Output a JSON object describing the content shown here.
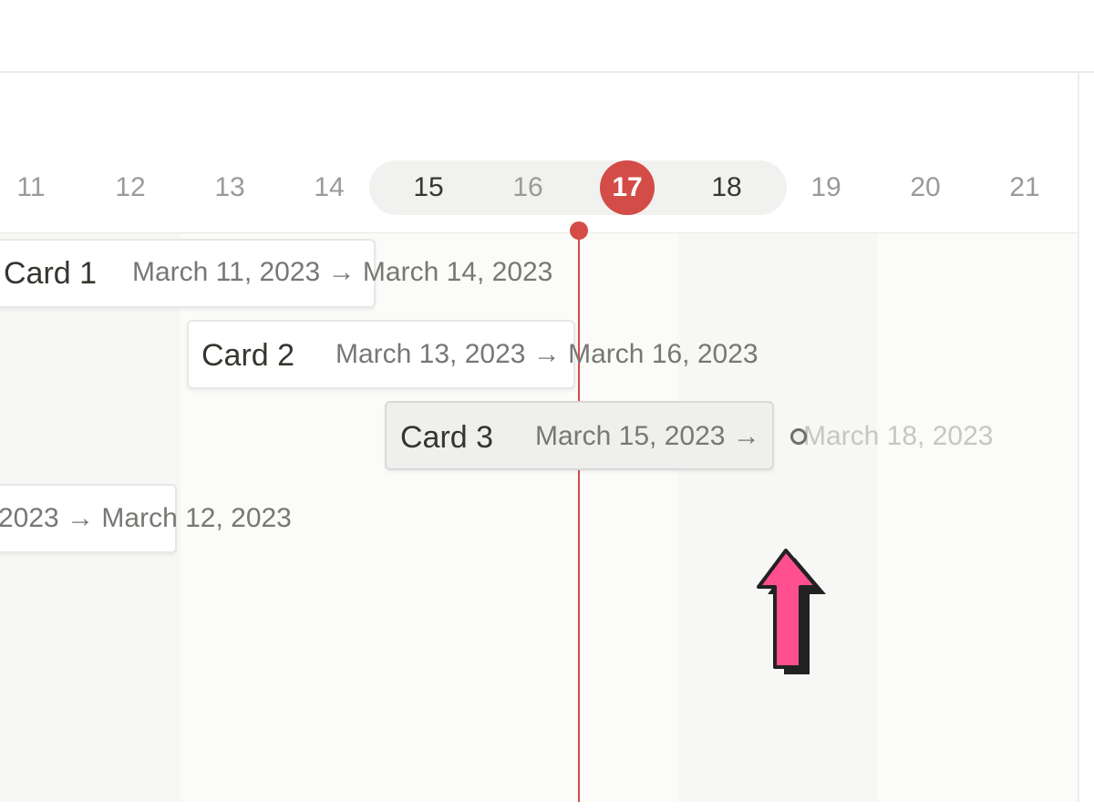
{
  "timeline": {
    "days": [
      {
        "label": "11",
        "state": "outside"
      },
      {
        "label": "12",
        "state": "outside"
      },
      {
        "label": "13",
        "state": "outside"
      },
      {
        "label": "14",
        "state": "outside"
      },
      {
        "label": "15",
        "state": "week"
      },
      {
        "label": "16",
        "state": "week-weekend"
      },
      {
        "label": "17",
        "state": "today"
      },
      {
        "label": "18",
        "state": "week"
      },
      {
        "label": "19",
        "state": "outside"
      },
      {
        "label": "20",
        "state": "outside"
      },
      {
        "label": "21",
        "state": "outside"
      }
    ],
    "today_label": "17",
    "today_color": "#d44c47"
  },
  "cards": [
    {
      "title": "Card 1",
      "dates": "March 11, 2023 → March 14, 2023"
    },
    {
      "title": "Card 2",
      "dates": "March 13, 2023 → March 16, 2023"
    },
    {
      "title": "Card 3",
      "dates_start": "March 15, 2023 →",
      "dates_end_ghost": "March 18, 2023",
      "state": "being-resized"
    },
    {
      "title": "",
      "dates": "2023 → March 12, 2023"
    }
  ],
  "annotation": {
    "icon": "arrow-up-icon",
    "color": "#ff4f8e"
  }
}
